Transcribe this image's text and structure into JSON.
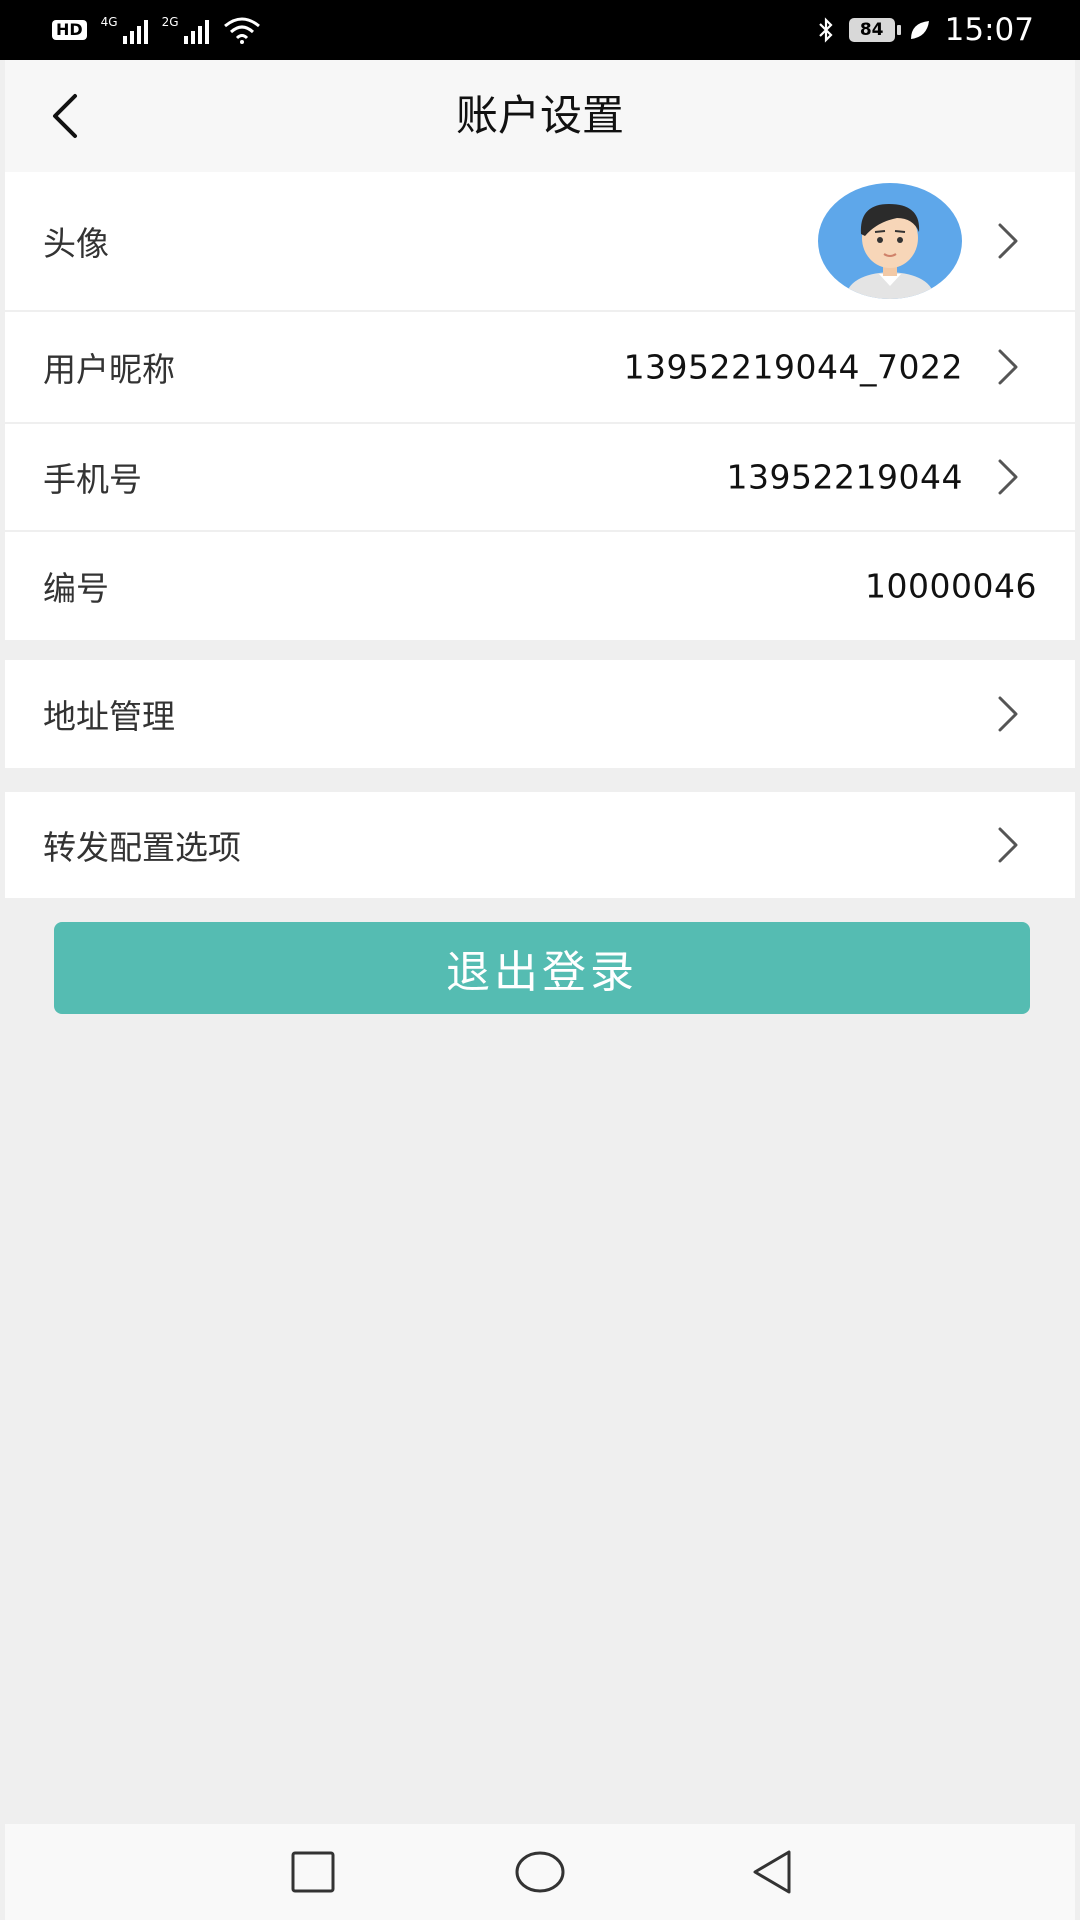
{
  "status_bar": {
    "hd_label": "HD",
    "net1_label": "4G",
    "net2_label": "2G",
    "battery_level": "84",
    "time": "15:07"
  },
  "header": {
    "title": "账户设置",
    "back_icon": "chevron-left-icon"
  },
  "profile": {
    "avatar_label": "头像",
    "nickname_label": "用户昵称",
    "nickname_value": "13952219044_7022",
    "phone_label": "手机号",
    "phone_value": "13952219044",
    "id_label": "编号",
    "id_value": "10000046"
  },
  "address": {
    "label": "地址管理"
  },
  "forward": {
    "label": "转发配置选项"
  },
  "logout": {
    "label": "退出登录",
    "color": "#55bcb2"
  },
  "nav": {
    "recents_icon": "square-icon",
    "home_icon": "circle-icon",
    "back_icon": "triangle-back-icon"
  }
}
